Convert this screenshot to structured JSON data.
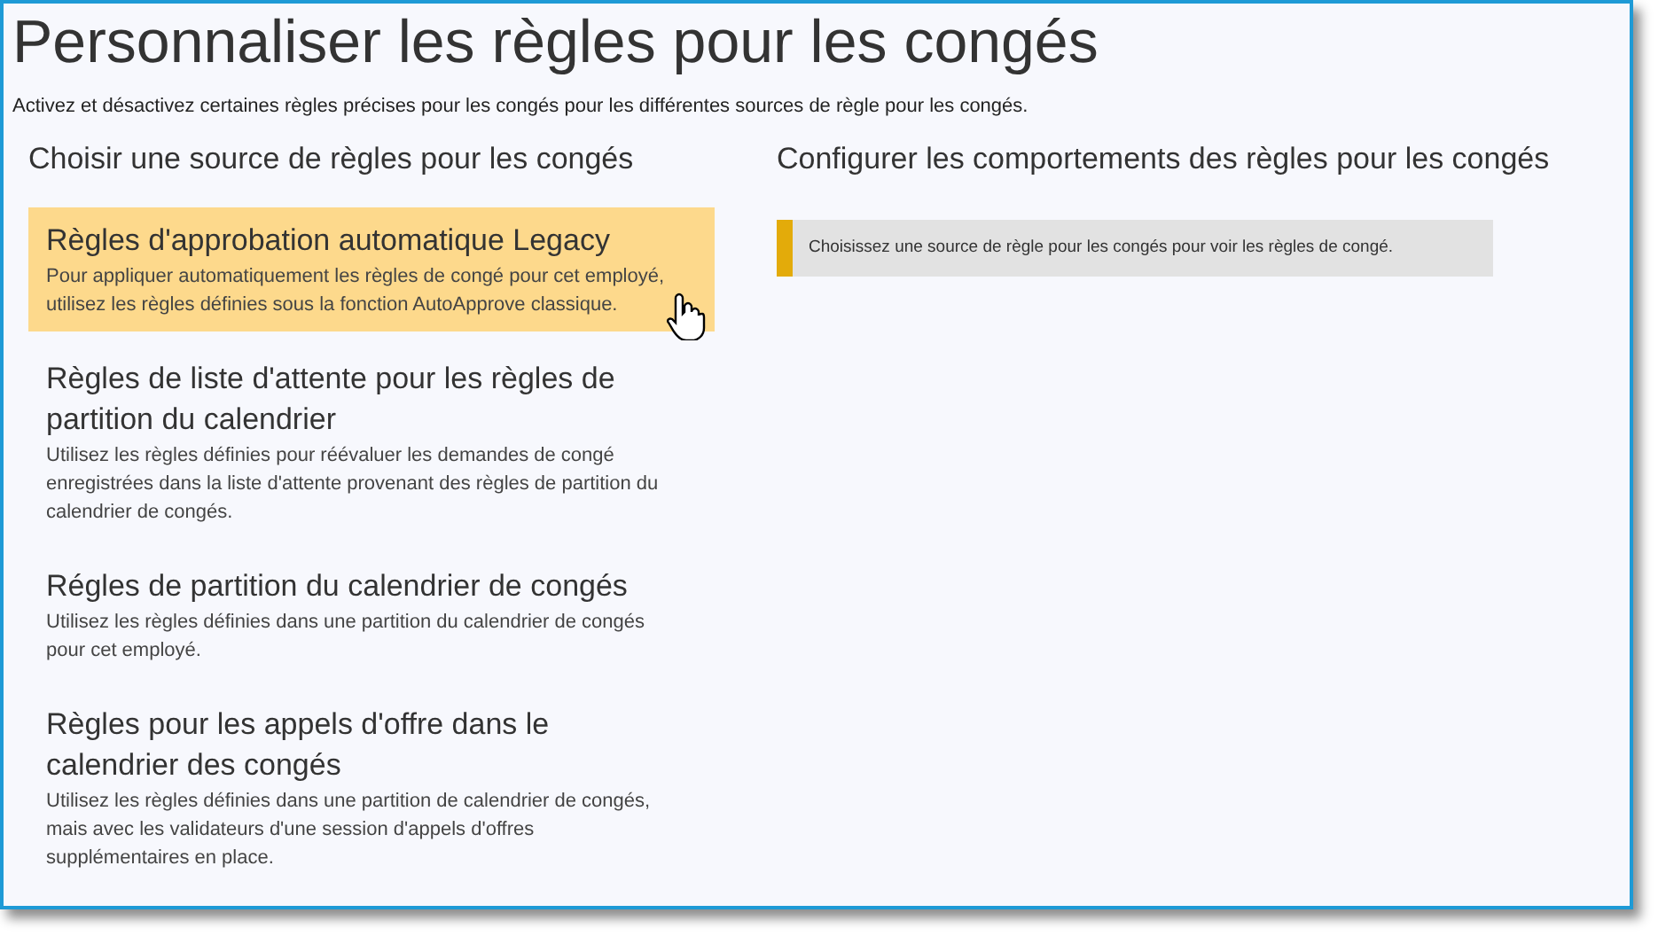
{
  "title": "Personnaliser les règles pour les congés",
  "subtitle": "Activez et désactivez certaines règles précises pour les congés pour les différentes sources de règle pour les congés.",
  "sources": {
    "heading": "Choisir une source de règles pour les congés",
    "items": [
      {
        "title": "Règles d'approbation automatique Legacy",
        "description": "Pour appliquer automatiquement les règles de congé pour cet employé, utilisez les règles définies sous la fonction AutoApprove classique.",
        "selected": true
      },
      {
        "title": "Règles de liste d'attente pour les règles de partition du calendrier",
        "description": "Utilisez les règles définies pour réévaluer les demandes de congé enregistrées dans la liste d'attente provenant des règles de partition du calendrier de congés.",
        "selected": false
      },
      {
        "title": "Régles de partition du calendrier de congés",
        "description": "Utilisez les règles définies dans une partition du calendrier de congés pour cet employé.",
        "selected": false
      },
      {
        "title": "Règles pour les appels d'offre dans le calendrier des congés",
        "description": "Utilisez les règles définies dans une partition de calendrier de congés, mais avec les validateurs d'une session d'appels d'offres supplémentaires en place.",
        "selected": false
      }
    ]
  },
  "behaviors": {
    "heading": "Configurer les comportements des règles pour les congés",
    "notice": "Choisissez une source de règle pour les congés pour voir les règles de congé."
  }
}
